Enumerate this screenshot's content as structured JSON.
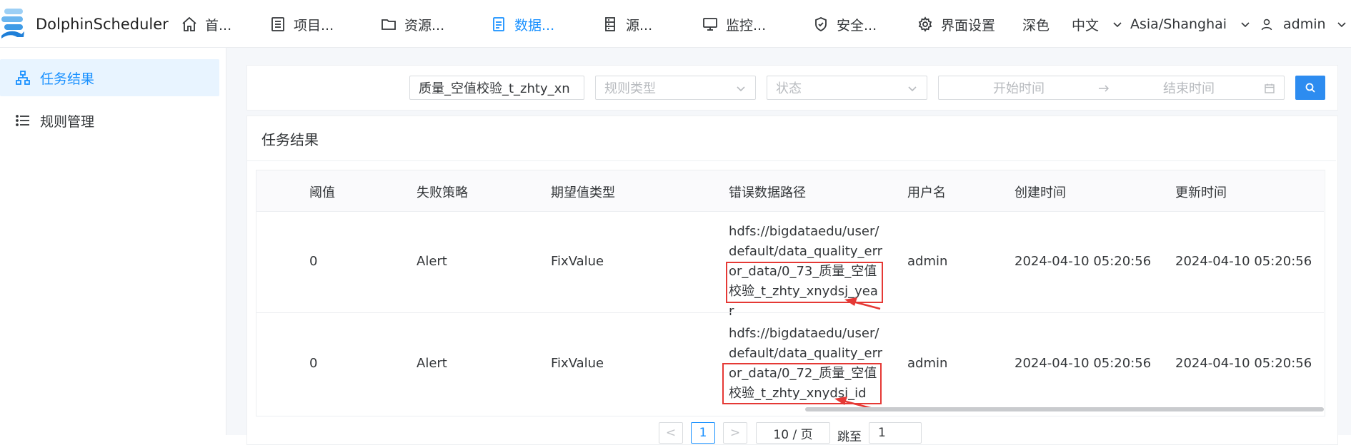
{
  "app": {
    "name": "DolphinScheduler"
  },
  "nav": {
    "items": [
      {
        "label": "首...",
        "icon": "home-icon"
      },
      {
        "label": "项目...",
        "icon": "project-icon"
      },
      {
        "label": "资源...",
        "icon": "folder-icon"
      },
      {
        "label": "数据...",
        "icon": "data-quality-icon",
        "active": true
      },
      {
        "label": "源...",
        "icon": "datasource-icon"
      },
      {
        "label": "监控...",
        "icon": "monitor-icon"
      },
      {
        "label": "安全...",
        "icon": "shield-icon"
      }
    ],
    "ui_settings": "界面设置",
    "theme": "深色",
    "language": "中文",
    "timezone": "Asia/Shanghai",
    "user": "admin"
  },
  "sidebar": {
    "items": [
      {
        "label": "任务结果",
        "icon": "sitemap-icon",
        "active": true
      },
      {
        "label": "规则管理",
        "icon": "list-icon"
      }
    ]
  },
  "filters": {
    "search_value": "质量_空值校验_t_zhty_xn",
    "rule_type_placeholder": "规则类型",
    "status_placeholder": "状态",
    "start_placeholder": "开始时间",
    "end_placeholder": "结束时间"
  },
  "card": {
    "title": "任务结果"
  },
  "table": {
    "columns": [
      "阈值",
      "失败策略",
      "期望值类型",
      "错误数据路径",
      "用户名",
      "创建时间",
      "更新时间"
    ],
    "rows": [
      {
        "threshold": "0",
        "failure_strategy": "Alert",
        "expected_type": "FixValue",
        "error_path": "hdfs://bigdataedu/user/default/data_quality_error_data/0_73_质量_空值校验_t_zhty_xnydsj_year",
        "user": "admin",
        "created": "2024-04-10 05:20:56",
        "updated": "2024-04-10 05:20:56"
      },
      {
        "threshold": "0",
        "failure_strategy": "Alert",
        "expected_type": "FixValue",
        "error_path": "hdfs://bigdataedu/user/default/data_quality_error_data/0_72_质量_空值校验_t_zhty_xnydsj_id",
        "user": "admin",
        "created": "2024-04-10 05:20:56",
        "updated": "2024-04-10 05:20:56"
      }
    ]
  },
  "pagination": {
    "prev": "<",
    "current": "1",
    "next": ">",
    "page_size": "10 / 页",
    "goto_label": "跳至",
    "goto_value": "1"
  },
  "colors": {
    "accent": "#1890ff",
    "highlight": "#e53935"
  }
}
